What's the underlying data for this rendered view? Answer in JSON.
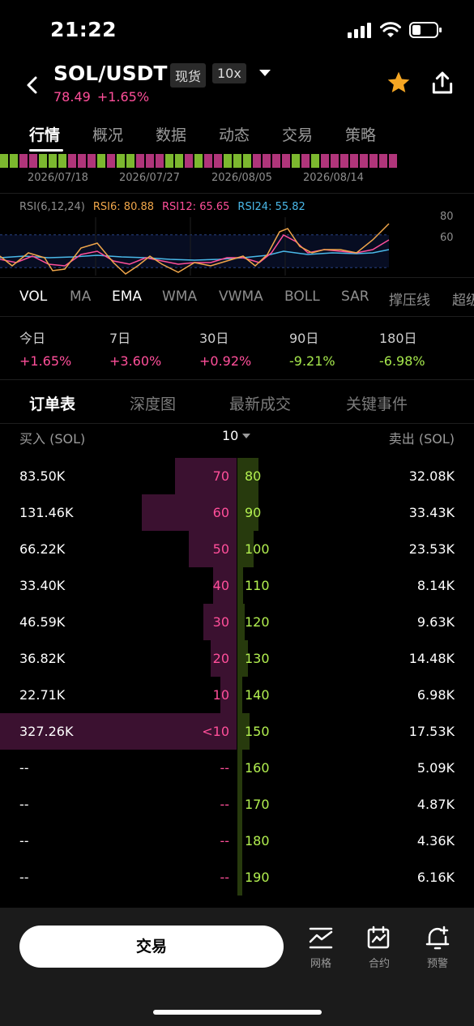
{
  "status": {
    "time": "21:22"
  },
  "header": {
    "pair": "SOL/USDT",
    "spot_tag": "现货",
    "leverage_tag": "10x",
    "price": "78.49",
    "change": "+1.65%",
    "icons": [
      "back-icon",
      "dropdown-icon",
      "star-icon",
      "share-icon"
    ]
  },
  "tabs": [
    "行情",
    "概况",
    "数据",
    "动态",
    "交易",
    "策略"
  ],
  "chart": {
    "dates": [
      "2026/07/18",
      "2026/07/27",
      "2026/08/05",
      "2026/08/14"
    ],
    "rsi_label": "RSI(6,12,24)",
    "rsi6": "RSI6: 80.88",
    "rsi12": "RSI12: 65.65",
    "rsi24": "RSI24: 55.82",
    "axis": [
      "80",
      "60"
    ],
    "colors": {
      "rsi6": "#f0a64a",
      "rsi12": "#ff4f9a",
      "rsi24": "#4ab8e8"
    }
  },
  "indicators": [
    "VOL",
    "MA",
    "EMA",
    "WMA",
    "VWMA",
    "BOLL",
    "SAR",
    "撑压线",
    "超级趋势"
  ],
  "periods": [
    {
      "label": "今日",
      "value": "+1.65%",
      "dir": "pos"
    },
    {
      "label": "7日",
      "value": "+3.60%",
      "dir": "pos"
    },
    {
      "label": "30日",
      "value": "+0.92%",
      "dir": "pos"
    },
    {
      "label": "90日",
      "value": "-9.21%",
      "dir": "neg"
    },
    {
      "label": "180日",
      "value": "-6.98%",
      "dir": "neg"
    }
  ],
  "subtabs": [
    "订单表",
    "深度图",
    "最新成交",
    "关键事件"
  ],
  "orderbook": {
    "buy_header": "买入 (SOL)",
    "depth": "10",
    "sell_header": "卖出 (SOL)",
    "rows": [
      {
        "buy": "83.50K",
        "bpct": "70",
        "sell_pct": "80",
        "sell": "32.08K",
        "bw": 0.26,
        "sw": 0.09
      },
      {
        "buy": "131.46K",
        "bpct": "60",
        "sell_pct": "90",
        "sell": "33.43K",
        "bw": 0.4,
        "sw": 0.09
      },
      {
        "buy": "66.22K",
        "bpct": "50",
        "sell_pct": "100",
        "sell": "23.53K",
        "bw": 0.2,
        "sw": 0.07
      },
      {
        "buy": "33.40K",
        "bpct": "40",
        "sell_pct": "110",
        "sell": "8.14K",
        "bw": 0.1,
        "sw": 0.025
      },
      {
        "buy": "46.59K",
        "bpct": "30",
        "sell_pct": "120",
        "sell": "9.63K",
        "bw": 0.14,
        "sw": 0.03
      },
      {
        "buy": "36.82K",
        "bpct": "20",
        "sell_pct": "130",
        "sell": "14.48K",
        "bw": 0.11,
        "sw": 0.045
      },
      {
        "buy": "22.71K",
        "bpct": "10",
        "sell_pct": "140",
        "sell": "6.98K",
        "bw": 0.07,
        "sw": 0.02
      },
      {
        "buy": "327.26K",
        "bpct": "<10",
        "sell_pct": "150",
        "sell": "17.53K",
        "bw": 1.0,
        "sw": 0.05
      },
      {
        "buy": "--",
        "bpct": "--",
        "sell_pct": "160",
        "sell": "5.09K",
        "bw": 0,
        "sw": 0.015
      },
      {
        "buy": "--",
        "bpct": "--",
        "sell_pct": "170",
        "sell": "4.87K",
        "bw": 0,
        "sw": 0.015
      },
      {
        "buy": "--",
        "bpct": "--",
        "sell_pct": "180",
        "sell": "4.36K",
        "bw": 0,
        "sw": 0.013
      },
      {
        "buy": "--",
        "bpct": "--",
        "sell_pct": "190",
        "sell": "6.16K",
        "bw": 0,
        "sw": 0.018
      }
    ]
  },
  "bottom": {
    "trade": "交易",
    "nav": [
      {
        "label": "网格",
        "icon": "grid-chart-icon"
      },
      {
        "label": "合约",
        "icon": "contract-icon"
      },
      {
        "label": "预警",
        "icon": "bell-alert-icon"
      }
    ]
  }
}
